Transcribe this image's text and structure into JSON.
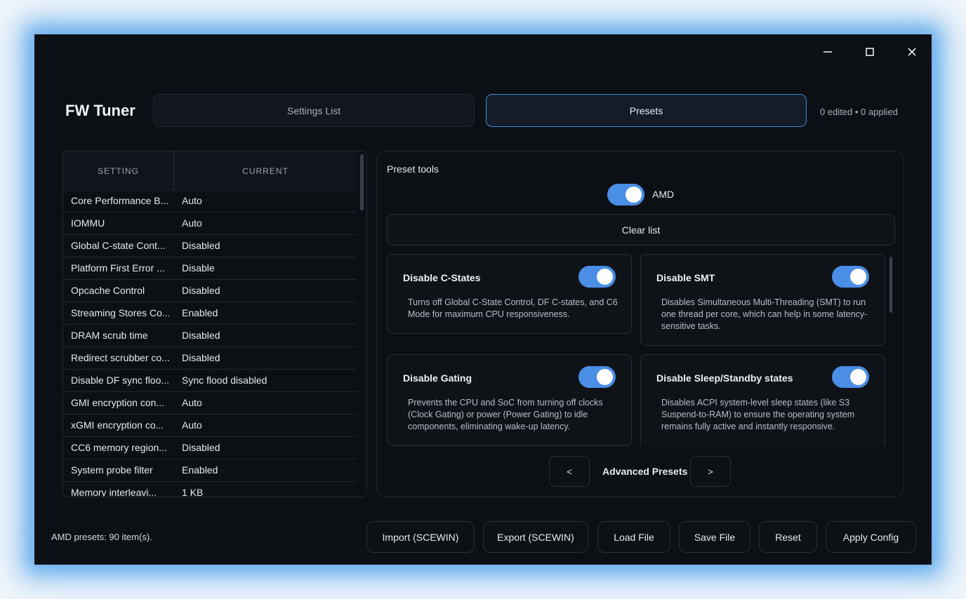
{
  "app": {
    "title": "FW Tuner"
  },
  "tabs": {
    "settings": "Settings List",
    "presets": "Presets"
  },
  "status_counts": "0 edited • 0 applied",
  "table": {
    "headers": {
      "setting": "SETTING",
      "current": "CURRENT"
    },
    "rows": [
      {
        "setting": "Core Performance B...",
        "current": "Auto"
      },
      {
        "setting": "IOMMU",
        "current": "Auto"
      },
      {
        "setting": "Global C-state Cont...",
        "current": "Disabled"
      },
      {
        "setting": "Platform First Error ...",
        "current": "Disable"
      },
      {
        "setting": "Opcache Control",
        "current": "Disabled"
      },
      {
        "setting": "Streaming Stores Co...",
        "current": "Enabled"
      },
      {
        "setting": "DRAM scrub time",
        "current": "Disabled"
      },
      {
        "setting": "Redirect scrubber co...",
        "current": "Disabled"
      },
      {
        "setting": "Disable DF sync floo...",
        "current": "Sync flood disabled"
      },
      {
        "setting": "GMI encryption con...",
        "current": "Auto"
      },
      {
        "setting": "xGMI encryption co...",
        "current": "Auto"
      },
      {
        "setting": "CC6 memory region...",
        "current": "Disabled"
      },
      {
        "setting": "System probe filter",
        "current": "Enabled"
      },
      {
        "setting": "Memory interleavi...",
        "current": "1 KB"
      }
    ]
  },
  "preset_tools": {
    "label": "Preset tools",
    "amd_toggle_label": "AMD",
    "amd_toggle_on": true,
    "clear_label": "Clear list"
  },
  "preset_cards": [
    {
      "title": "Disable C-States",
      "description": "Turns off Global C-State Control, DF C-states, and C6 Mode for maximum CPU responsiveness.",
      "enabled": true
    },
    {
      "title": "Disable SMT",
      "description": "Disables Simultaneous Multi-Threading (SMT) to run one thread per core, which can help in some latency-sensitive tasks.",
      "enabled": true
    },
    {
      "title": "Disable Gating",
      "description": "Prevents the CPU and SoC from turning off clocks (Clock Gating) or power (Power Gating) to idle components, eliminating wake-up latency.",
      "enabled": true
    },
    {
      "title": "Disable Sleep/Standby states",
      "description": "Disables ACPI system-level sleep states (like S3 Suspend-to-RAM) to ensure the operating system remains fully active and instantly responsive.",
      "enabled": true
    }
  ],
  "pager": {
    "prev": "<",
    "label": "Advanced Presets",
    "next": ">"
  },
  "footer": {
    "status": "AMD presets: 90 item(s).",
    "buttons": {
      "import": "Import (SCEWIN)",
      "export": "Export (SCEWIN)",
      "load": "Load File",
      "save": "Save File",
      "reset": "Reset",
      "apply": "Apply Config"
    }
  },
  "colors": {
    "accent": "#4a8ee6",
    "background": "#0c0f14",
    "tab_border": "#3d8ee0"
  }
}
